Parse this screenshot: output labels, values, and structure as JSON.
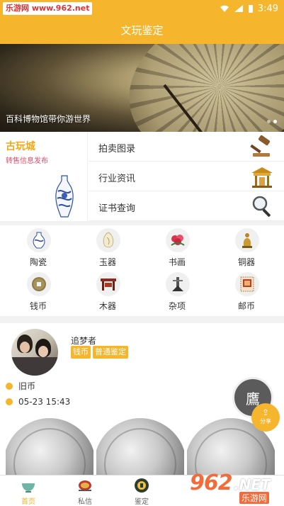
{
  "status_bar": {
    "watermark": "乐游网 www.962.net",
    "time": "3:49"
  },
  "header": {
    "title": "文玩鉴定"
  },
  "banner": {
    "caption": "百科博物馆带你游世界",
    "slide_count": 2,
    "active_slide": 2
  },
  "market": {
    "title": "古玩城",
    "subtitle": "转售信息发布",
    "links": [
      {
        "label": "拍卖图录",
        "icon": "gavel-icon"
      },
      {
        "label": "行业资讯",
        "icon": "pavilion-icon"
      },
      {
        "label": "证书查询",
        "icon": "magnifier-icon"
      }
    ]
  },
  "categories": [
    {
      "label": "陶瓷",
      "icon": "porcelain-vase-icon"
    },
    {
      "label": "玉器",
      "icon": "jade-icon"
    },
    {
      "label": "书画",
      "icon": "painting-icon"
    },
    {
      "label": "铜器",
      "icon": "bronze-statue-icon"
    },
    {
      "label": "钱币",
      "icon": "coin-icon"
    },
    {
      "label": "木器",
      "icon": "wood-furniture-icon"
    },
    {
      "label": "杂项",
      "icon": "misc-icon"
    },
    {
      "label": "邮币",
      "icon": "stamp-icon"
    }
  ],
  "post": {
    "username": "追梦者",
    "tags": [
      "钱币",
      "普通鉴定"
    ],
    "category": "旧币",
    "time": "05-23 15:43"
  },
  "floating": {
    "seal_text": "鷹",
    "share_label": "分享"
  },
  "bottom_nav": [
    {
      "label": "首页",
      "icon": "home-bowl-icon",
      "active": true
    },
    {
      "label": "私信",
      "icon": "message-drum-icon",
      "active": false
    },
    {
      "label": "鉴定",
      "icon": "appraise-seal-icon",
      "active": false
    }
  ],
  "site_logo": {
    "big": "962",
    "net": ".NET",
    "cn": "乐游网"
  },
  "colors": {
    "accent": "#f5b52d",
    "market_title": "#f0a819",
    "market_sub": "#e24b6a"
  }
}
